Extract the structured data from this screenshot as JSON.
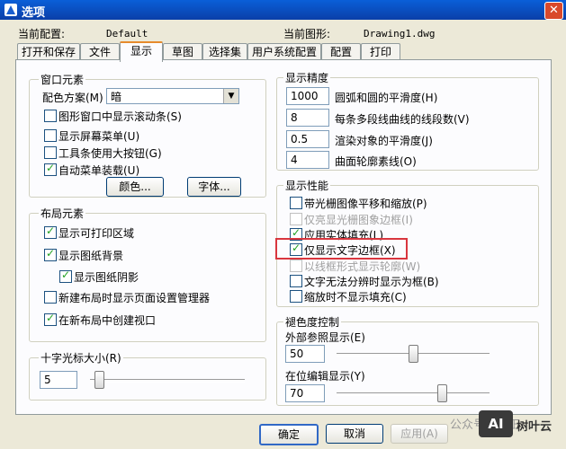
{
  "window": {
    "title": "选项",
    "close": "✕"
  },
  "profile": {
    "config_label": "当前配置:",
    "config_value": "Default",
    "drawing_label": "当前图形:",
    "drawing_value": "Drawing1.dwg"
  },
  "tabs": [
    {
      "label": "打开和保存",
      "active": false
    },
    {
      "label": "文件",
      "active": false
    },
    {
      "label": "显示",
      "active": true
    },
    {
      "label": "草图",
      "active": false
    },
    {
      "label": "选择集",
      "active": false
    },
    {
      "label": "用户系统配置",
      "active": false
    },
    {
      "label": "配置",
      "active": false
    },
    {
      "label": "打印",
      "active": false
    }
  ],
  "window_elements": {
    "title": "窗口元素",
    "color_scheme_label": "配色方案(M)",
    "color_scheme_value": "暗",
    "checkboxes": [
      {
        "label": "图形窗口中显示滚动条(S)",
        "checked": false
      },
      {
        "label": "显示屏幕菜单(U)",
        "checked": false
      },
      {
        "label": "工具条使用大按钮(G)",
        "checked": false
      },
      {
        "label": "自动菜单装载(U)",
        "checked": true
      }
    ],
    "color_button": "颜色...",
    "font_button": "字体..."
  },
  "layout_elements": {
    "title": "布局元素",
    "checkboxes": [
      {
        "label": "显示可打印区域",
        "checked": true
      },
      {
        "label": "显示图纸背景",
        "checked": true
      },
      {
        "label": "显示图纸阴影",
        "checked": true
      },
      {
        "label": "新建布局时显示页面设置管理器",
        "checked": false
      },
      {
        "label": "在新布局中创建视口",
        "checked": true
      }
    ]
  },
  "crosshair": {
    "title": "十字光标大小(R)",
    "value": "5",
    "level_percent": 3
  },
  "display_resolution": {
    "title": "显示精度",
    "rows": [
      {
        "value": "1000",
        "label": "圆弧和圆的平滑度(H)"
      },
      {
        "value": "8",
        "label": "每条多段线曲线的线段数(V)"
      },
      {
        "value": "0.5",
        "label": "渲染对象的平滑度(J)"
      },
      {
        "value": "4",
        "label": "曲面轮廓素线(O)"
      }
    ]
  },
  "display_performance": {
    "title": "显示性能",
    "checkboxes": [
      {
        "label": "带光栅图像平移和缩放(P)",
        "checked": false,
        "disabled": false
      },
      {
        "label": "仅亮显光栅图象边框(I)",
        "checked": false,
        "disabled": true
      },
      {
        "label": "应用实体填充(L)",
        "checked": true,
        "disabled": false
      },
      {
        "label": "仅显示文字边框(X)",
        "checked": true,
        "disabled": false
      },
      {
        "label": "以线框形式显示轮廓(W)",
        "checked": false,
        "disabled": true
      },
      {
        "label": "文字无法分辨时显示为框(B)",
        "checked": false,
        "disabled": false
      },
      {
        "label": "缩放时不显示填充(C)",
        "checked": false,
        "disabled": false
      }
    ]
  },
  "fade": {
    "title": "褪色度控制",
    "xref_label": "外部参照显示(E)",
    "xref_value": "50",
    "xref_level_percent": 50,
    "inplace_label": "在位编辑显示(Y)",
    "inplace_value": "70",
    "inplace_level_percent": 70
  },
  "buttons": {
    "ok": "确定",
    "cancel": "取消",
    "apply": "应用(A)"
  },
  "watermark": {
    "text": "公众号 · 天正",
    "logo": "AI",
    "brand": "树叶云"
  },
  "colors": {
    "title_bar": "#0a4fc8",
    "dialog": "#ece9d8",
    "highlight": "#d9363e",
    "active_tab": "#e68b2c"
  }
}
